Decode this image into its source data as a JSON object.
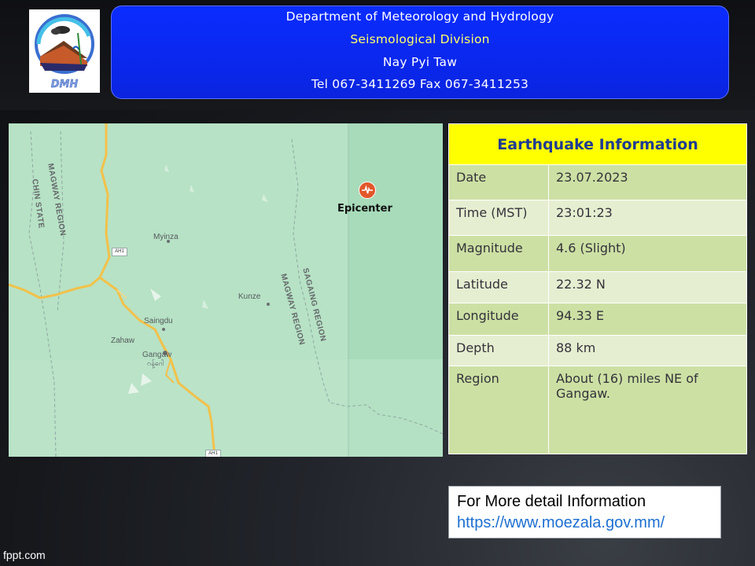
{
  "header": {
    "logo_text": "DMH",
    "line1": "Department of Meteorology and Hydrology",
    "line2": "Seismological Division",
    "line3": "Nay Pyi Taw",
    "line4": "Tel 067-3411269 Fax 067-3411253",
    "accent_color": "#0a2cff",
    "subtitle_color": "#ffff66"
  },
  "map": {
    "epicenter_label": "Epicenter",
    "epicenter_icon": "seismic-pulse-icon",
    "places": [
      "Myinza",
      "Kunze",
      "Saingdu",
      "Zahaw",
      "Gangaw",
      "ဂန့်ဂေါ"
    ],
    "regions": [
      "MAGWAY REGION",
      "CHIN STATE",
      "MAGWAY REGION",
      "SAGAING REGION"
    ],
    "road_shields": [
      "AH1",
      "AH1"
    ],
    "land_color": "#b7e2c5",
    "road_color": "#f2c14a"
  },
  "info": {
    "title": "Earthquake Information",
    "title_bg": "#ffff00",
    "rows": [
      {
        "label": "Date",
        "value": "23.07.2023"
      },
      {
        "label": "Time (MST)",
        "value": "23:01:23"
      },
      {
        "label": "Magnitude",
        "value": "4.6 (Slight)"
      },
      {
        "label": "Latitude",
        "value": "22.32  N"
      },
      {
        "label": "Longitude",
        "value": "94.33  E"
      },
      {
        "label": "Depth",
        "value": "88  km"
      },
      {
        "label": "Region",
        "value": "About  (16)  miles  NE  of Gangaw."
      }
    ]
  },
  "footer": {
    "line1": "For More detail Information",
    "line2": "https://www.moezala.gov.mm/",
    "link_color": "#1c6fd1"
  },
  "watermark": "fppt.com"
}
